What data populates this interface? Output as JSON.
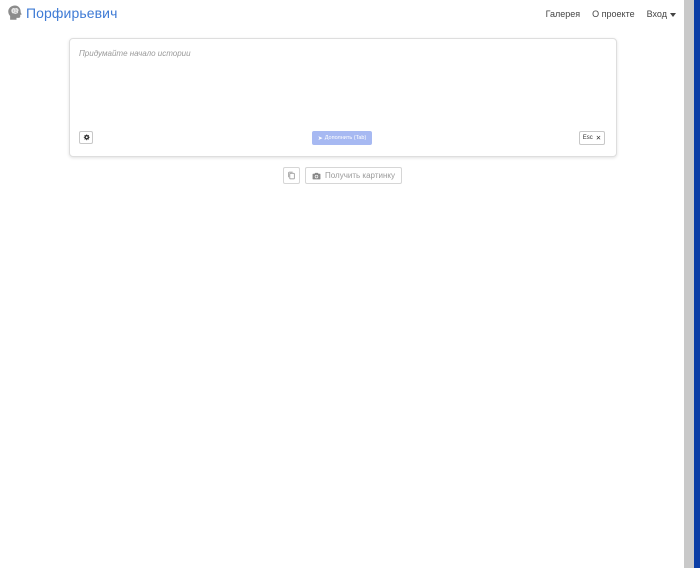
{
  "navbar": {
    "brand": "Порфирьевич",
    "links": {
      "gallery": "Галерея",
      "about": "О проекте",
      "login": "Вход"
    }
  },
  "editor": {
    "placeholder": "Придумайте начало истории",
    "value": "",
    "complete_label": "Дополнить (Tab)",
    "esc_label": "Esc"
  },
  "actions": {
    "picture_label": "Получить картинку"
  },
  "icons": {
    "brand": "brain-head-icon",
    "settings": "gear-icon",
    "complete": "send-arrow-icon",
    "esc": "close-icon",
    "copy": "copy-icon",
    "picture": "camera-icon",
    "login": "caret-down-icon"
  },
  "colors": {
    "brand": "#3f7bd5",
    "complete_button": "#a7b9f2",
    "scroll_thumb": "#0c3ea6"
  }
}
